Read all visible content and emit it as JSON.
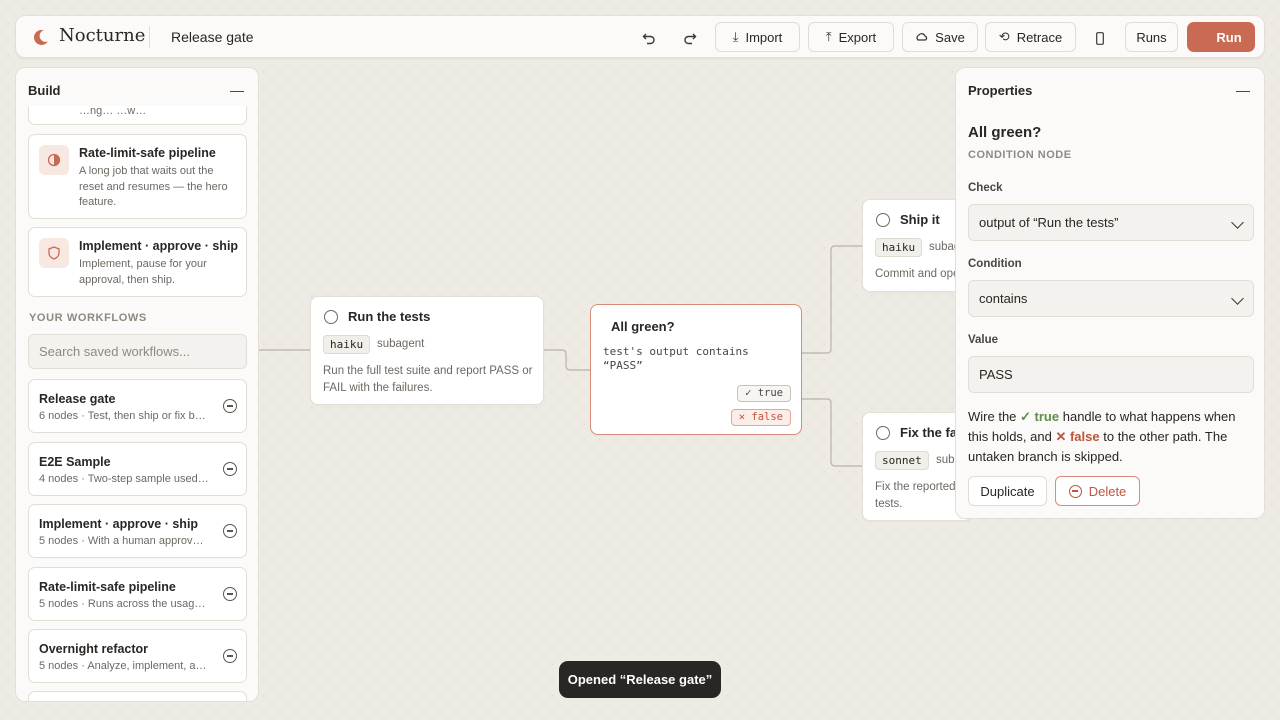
{
  "app": {
    "brand": "Nocturne",
    "workflow_title": "Release gate"
  },
  "toolbar": {
    "import_label": "Import",
    "export_label": "Export",
    "save_label": "Save",
    "retrace_label": "Retrace",
    "runs_label": "Runs",
    "run_label": "Run",
    "accent_color": "#c96a52"
  },
  "build_panel": {
    "title": "Build",
    "partial_text": "…ng…  …w…",
    "templates": [
      {
        "name": "Rate-limit-safe pipeline",
        "description": "A long job that waits out the reset and resumes — the hero feature.",
        "icon": "half-circle-icon"
      },
      {
        "name": "Implement · approve · ship",
        "description": "Implement, pause for your approval, then ship.",
        "icon": "shield-icon"
      }
    ],
    "section_label": "YOUR WORKFLOWS",
    "search_placeholder": "Search saved workflows...",
    "workflows": [
      {
        "name": "Release gate",
        "meta": "6 nodes · Test, then ship or fix ba..."
      },
      {
        "name": "E2E Sample",
        "meta": "4 nodes · Two-step sample used ..."
      },
      {
        "name": "Implement · approve · ship",
        "meta": "5 nodes · With a human approval ..."
      },
      {
        "name": "Rate-limit-safe pipeline",
        "meta": "5 nodes · Runs across the usage-li..."
      },
      {
        "name": "Overnight refactor",
        "meta": "5 nodes · Analyze, implement, an..."
      }
    ]
  },
  "canvas": {
    "nodes": {
      "run_tests": {
        "title": "Run the tests",
        "model": "haiku",
        "kind": "subagent",
        "description_line1": "Run the full test suite and report PASS or",
        "description_line2": "FAIL with the failures."
      },
      "all_green": {
        "title": "All green?",
        "expression_line1": "test's output contains",
        "expression_line2": "“PASS”",
        "true_tag": "✓ true",
        "false_tag": "✕ false"
      },
      "ship_it": {
        "title": "Ship it",
        "model": "haiku",
        "kind": "subag",
        "description": "Commit and ope"
      },
      "fix_failures": {
        "title": "Fix the fa",
        "model": "sonnet",
        "kind": "suba",
        "description_line1": "Fix the reported",
        "description_line2": "tests."
      }
    }
  },
  "properties": {
    "title": "Properties",
    "node_name": "All green?",
    "node_type": "CONDITION NODE",
    "check_label": "Check",
    "check_value": "output of “Run the tests”",
    "condition_label": "Condition",
    "condition_value": "contains",
    "value_label": "Value",
    "value": "PASS",
    "help_wire": "Wire the",
    "help_true": "✓ true",
    "help_mid": "handle to what happens when this holds, and",
    "help_false": "✕ false",
    "help_end": "to the other path. The untaken branch is skipped.",
    "duplicate_label": "Duplicate",
    "delete_label": "Delete"
  },
  "toast": {
    "message": "Opened “Release gate”"
  }
}
